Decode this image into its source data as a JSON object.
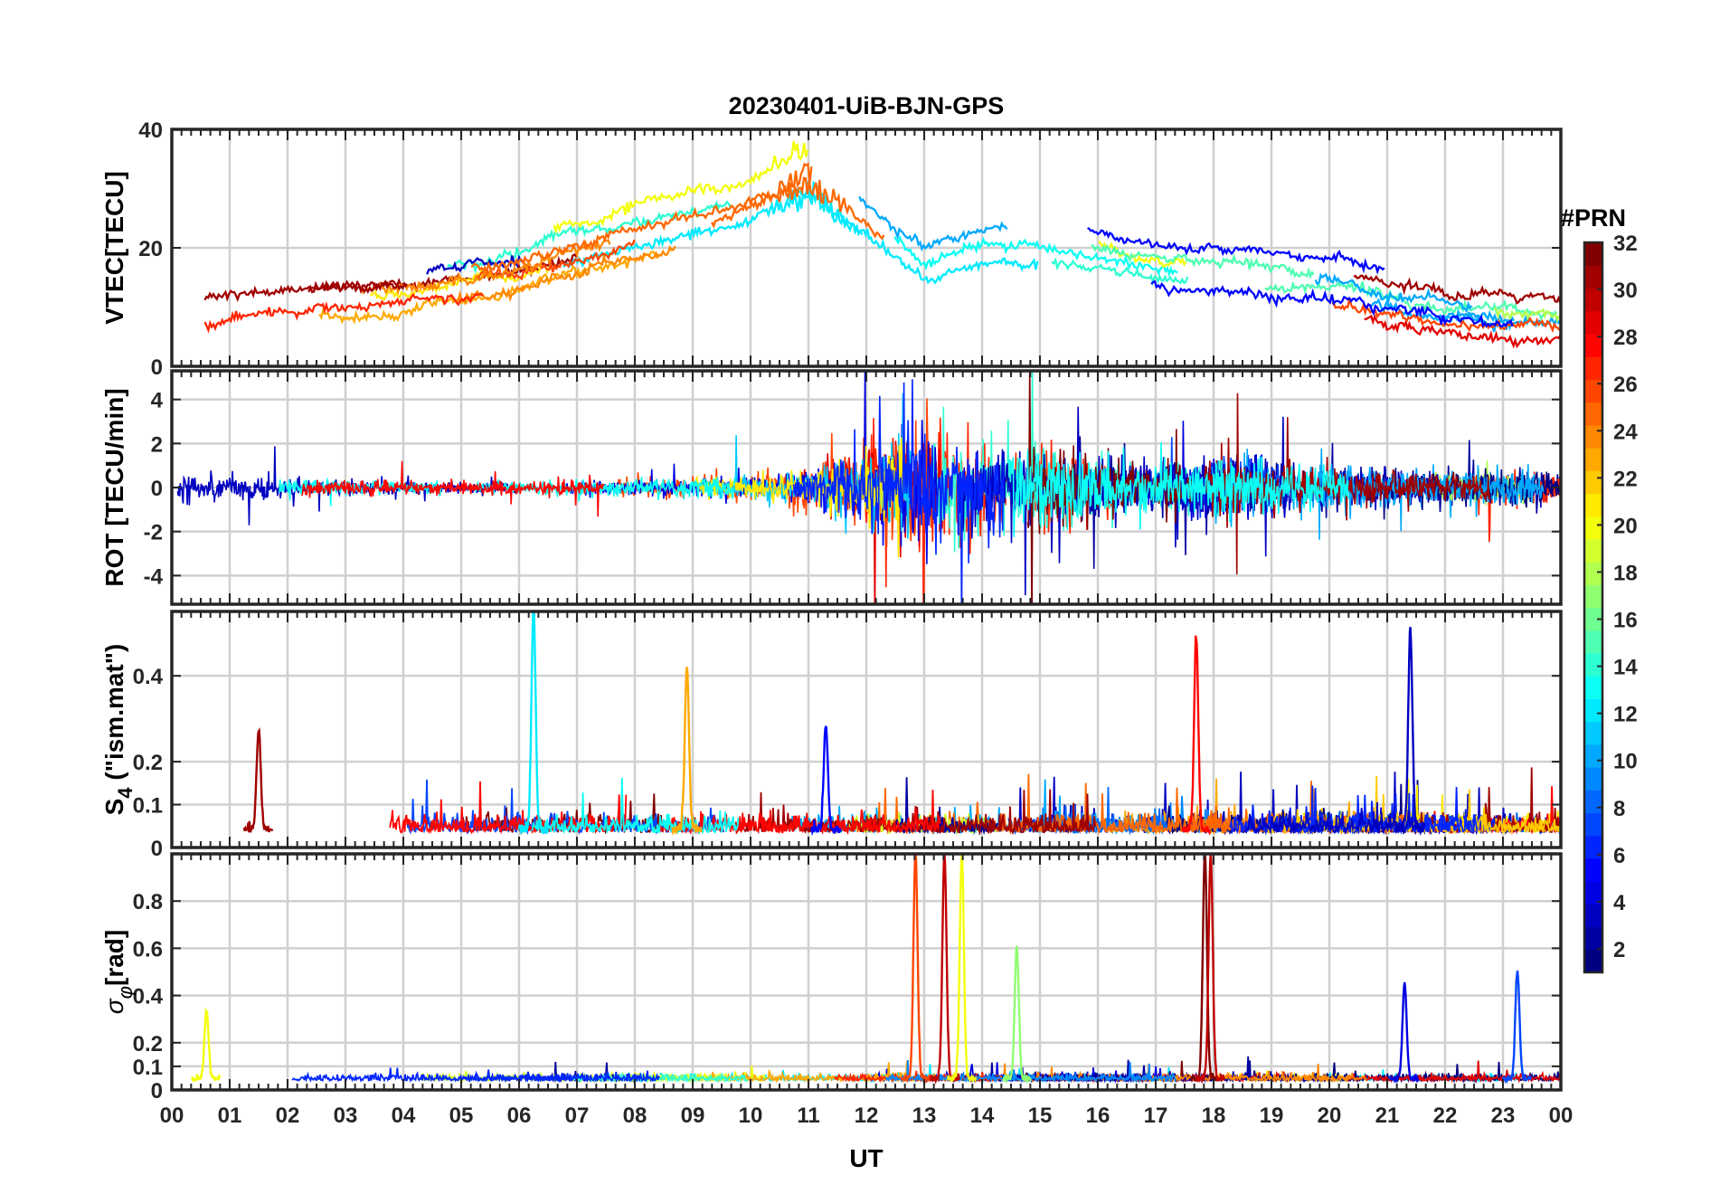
{
  "title": "20230401-UiB-BJN-GPS",
  "x_axis": {
    "label": "UT",
    "range": [
      0,
      24
    ],
    "tick_labels": [
      "00",
      "01",
      "02",
      "03",
      "04",
      "05",
      "06",
      "07",
      "08",
      "09",
      "10",
      "11",
      "12",
      "13",
      "14",
      "15",
      "16",
      "17",
      "18",
      "19",
      "20",
      "21",
      "22",
      "23",
      "00"
    ]
  },
  "colorbar": {
    "title": "#PRN",
    "range": [
      1,
      32
    ],
    "tick_labels": [
      "2",
      "4",
      "6",
      "8",
      "10",
      "12",
      "14",
      "16",
      "18",
      "20",
      "22",
      "24",
      "26",
      "28",
      "30",
      "32"
    ],
    "colormap": "jet"
  },
  "chart_data": [
    {
      "type": "line",
      "panel": "vtec",
      "ylabel": "VTEC[TECU]",
      "ylim": [
        0,
        40
      ],
      "yticks": [
        0,
        20,
        40
      ],
      "grid": true,
      "series_note_values": {
        "baseline_profile": [
          [
            0,
            10
          ],
          [
            2,
            13
          ],
          [
            4,
            14
          ],
          [
            6,
            17
          ],
          [
            8,
            22
          ],
          [
            10,
            26
          ],
          [
            11,
            29
          ],
          [
            12,
            24
          ],
          [
            13,
            17
          ],
          [
            14,
            19
          ],
          [
            15,
            19
          ],
          [
            16,
            17
          ],
          [
            17,
            15
          ],
          [
            18,
            14
          ],
          [
            19,
            13
          ],
          [
            20,
            12
          ],
          [
            21,
            11
          ],
          [
            22,
            9
          ],
          [
            23,
            8
          ],
          [
            24,
            8
          ]
        ],
        "peak_value_near_11UT": 33
      }
    },
    {
      "type": "line",
      "panel": "rot",
      "ylabel": "ROT [TECU/min]",
      "ylim": [
        -5.3,
        5.3
      ],
      "yticks": [
        -4,
        -2,
        0,
        2,
        4
      ],
      "grid": true,
      "series_note_values": {
        "amplitude_profile": [
          [
            0,
            1.2
          ],
          [
            1,
            0.8
          ],
          [
            3,
            0.5
          ],
          [
            6,
            0.4
          ],
          [
            9,
            0.6
          ],
          [
            11,
            1.0
          ],
          [
            12.5,
            3.0
          ],
          [
            13,
            3.5
          ],
          [
            15,
            2.5
          ],
          [
            17,
            1.2
          ],
          [
            18,
            2.0
          ],
          [
            20,
            1.2
          ],
          [
            22,
            1.0
          ],
          [
            24,
            1.0
          ]
        ]
      }
    },
    {
      "type": "line",
      "panel": "s4",
      "ylabel": "S4 (\"ism.mat\")",
      "ylim": [
        0,
        0.55
      ],
      "yticks": [
        0,
        0.1,
        0.2,
        0.4
      ],
      "grid": true,
      "series_note_values": {
        "notable_peaks": [
          [
            6.25,
            0.55,
            12
          ],
          [
            8.9,
            0.42,
            23
          ],
          [
            17.7,
            0.48,
            28
          ],
          [
            21.4,
            0.5,
            3
          ],
          [
            11.3,
            0.28,
            5
          ],
          [
            1.5,
            0.27,
            31
          ]
        ]
      }
    },
    {
      "type": "line",
      "panel": "sigma_phi",
      "ylabel": "σφ[rad]",
      "ylim": [
        0,
        1.0
      ],
      "yticks": [
        0,
        0.1,
        0.2,
        0.4,
        0.6,
        0.8
      ],
      "grid": true,
      "series_note_values": {
        "notable_peaks": [
          [
            12.85,
            1.0,
            26
          ],
          [
            13.35,
            1.0,
            30
          ],
          [
            13.65,
            1.0,
            20
          ],
          [
            17.85,
            1.0,
            32
          ],
          [
            17.95,
            1.0,
            30
          ],
          [
            14.6,
            0.6,
            17
          ],
          [
            21.3,
            0.45,
            4
          ],
          [
            23.25,
            0.5,
            7
          ],
          [
            0.6,
            0.33,
            20
          ]
        ]
      }
    }
  ]
}
